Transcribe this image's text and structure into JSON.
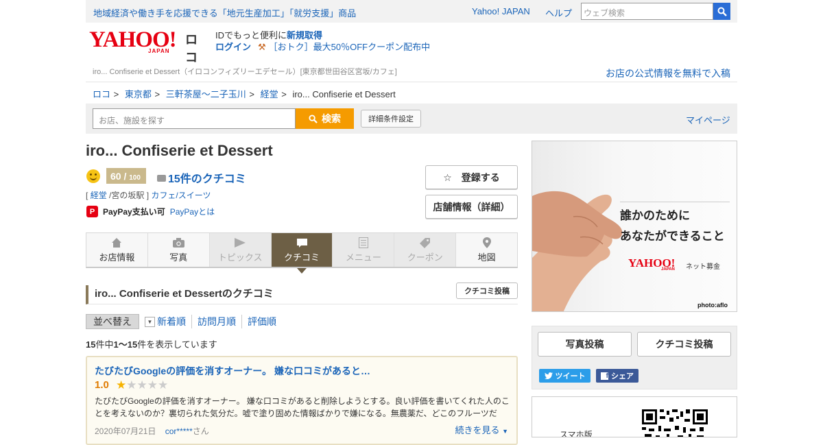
{
  "topbar": {
    "promo": "地域経済や働き手を応援できる「地元生産加工」「就労支援」商品",
    "yahoo_japan": "Yahoo! JAPAN",
    "help": "ヘルプ",
    "search_placeholder": "ウェブ検索"
  },
  "header": {
    "logo_yahoo": "YAHOO!",
    "logo_japan": "JAPAN",
    "logo_loco": "ロコ",
    "id_text": "IDでもっと便利に",
    "signup": "新規取得",
    "login": "ログイン",
    "coupon": "［おトク］最大50％OFFクーポン配布中",
    "sub_info": "iro... Confiserie et Dessert（イロコンフィズリーエデセール）[東京都世田谷区宮坂/カフェ]",
    "free_info": "お店の公式情報を無料で入稿"
  },
  "breadcrumb": [
    "ロコ",
    "東京都",
    "三軒茶屋～二子玉川",
    "経堂",
    "iro... Confiserie et Dessert"
  ],
  "breadcrumb_sep": ">",
  "searchbar": {
    "placeholder": "お店、施設を探す",
    "button": "検索",
    "advanced": "詳細条件設定",
    "mypage": "マイページ"
  },
  "shop": {
    "name": "iro... Confiserie et Dessert",
    "score": "60",
    "score_max": "100",
    "score_sep": "/",
    "review_count": "15件のクチコミ",
    "cat_open": "[",
    "station_link": "経堂",
    "station_other": "/宮の坂駅",
    "cat_close": "]",
    "category": "カフェ/スイーツ",
    "paypay_icon": "P",
    "paypay": "PayPay支払い可",
    "paypay_link": "PayPayとは",
    "register_button": "☆　登録する",
    "info_button": "店舗情報（詳細）"
  },
  "tabs": [
    {
      "label": "お店情報",
      "icon": "home-icon",
      "state": "normal"
    },
    {
      "label": "写真",
      "icon": "camera-icon",
      "state": "normal"
    },
    {
      "label": "トピックス",
      "icon": "flag-icon",
      "state": "disabled"
    },
    {
      "label": "クチコミ",
      "icon": "comment-icon",
      "state": "active"
    },
    {
      "label": "メニュー",
      "icon": "menu-icon",
      "state": "disabled"
    },
    {
      "label": "クーポン",
      "icon": "tag-icon",
      "state": "disabled"
    },
    {
      "label": "地図",
      "icon": "map-pin-icon",
      "state": "normal"
    }
  ],
  "reviews_section": {
    "title": "iro... Confiserie et Dessertのクチコミ",
    "post_button": "クチコミ投稿",
    "sort_label": "並べ替え",
    "sort_options": [
      "新着順",
      "訪問月順",
      "評価順"
    ],
    "count_total": "15",
    "count_range": "1～15",
    "count_prefix": "件中",
    "count_suffix": "件を表示しています"
  },
  "review": {
    "title": "たびたびGoogleの評価を消すオーナー。 嫌な口コミがあると…",
    "rating": "1.0",
    "stars": 1,
    "body": "たびたびGoogleの評価を消すオーナー。 嫌な口コミがあると削除しようとする。良い評価を書いてくれた人のことを考えないのか？裏切られた気分だ。嘘で塗り固めた情報ばかりで嫌になる。無農薬だ、どこのフルーツだ",
    "date": "2020年07月21日",
    "user": "cor*****",
    "user_suffix": "さん",
    "more": "続きを見る"
  },
  "ad": {
    "line1": "誰かのために",
    "line2": "あなたができること",
    "brand": "YAHOO!",
    "brand_sub": "JAPAN",
    "service": "ネット募金",
    "credit": "photo:aflo"
  },
  "side": {
    "photo_post": "写真投稿",
    "review_post": "クチコミ投稿",
    "tweet": "ツイート",
    "share": "シェア",
    "qr_text": "スマホ版"
  },
  "colors": {
    "link": "#1a64b8",
    "accent": "#f59b00",
    "active_tab": "#6d5f45",
    "brand_red": "#e60012"
  }
}
